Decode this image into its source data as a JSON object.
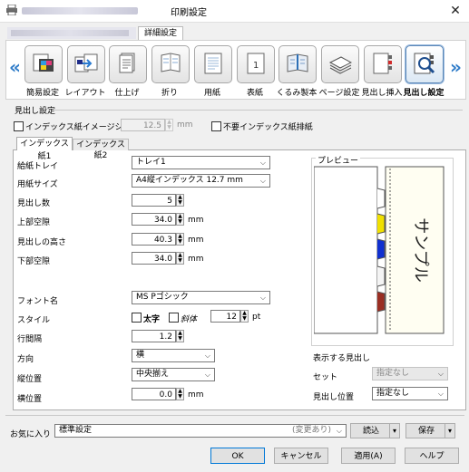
{
  "window": {
    "title": "印刷設定",
    "close_glyph": "✕"
  },
  "tabs": {
    "detail": "詳細設定"
  },
  "ribbon": {
    "items": [
      {
        "label": "簡易設定"
      },
      {
        "label": "レイアウト"
      },
      {
        "label": "仕上げ"
      },
      {
        "label": "折り"
      },
      {
        "label": "用紙"
      },
      {
        "label": "表紙"
      },
      {
        "label": "くるみ製本"
      },
      {
        "label": "ページ設定"
      },
      {
        "label": "見出し挿入"
      },
      {
        "label": "見出し設定"
      }
    ],
    "active_index": 9,
    "left_chevron": "«",
    "right_chevron": "»",
    "cover_icon_number": "1"
  },
  "section": {
    "title": "見出し設定",
    "shift_label": "インデックス紙イメージシフト",
    "shift_value": "12.5",
    "shift_unit": "mm",
    "discard_label": "不要インデックス紙排紙"
  },
  "subtabs": [
    "インデックス紙1",
    "インデックス紙2"
  ],
  "form": {
    "tray_label": "給紙トレイ",
    "tray_value": "トレイ1",
    "size_label": "用紙サイズ",
    "size_value": "A4縦インデックス 12.7 mm",
    "count_label": "見出し数",
    "count_value": "5",
    "top_label": "上部空隙",
    "top_value": "34.0",
    "height_label": "見出しの高さ",
    "height_value": "40.3",
    "bottom_label": "下部空隙",
    "bottom_value": "34.0",
    "unit": "mm",
    "font_label": "フォント名",
    "font_value": "MS Pゴシック",
    "style_label": "スタイル",
    "bold_label": "太字",
    "italic_label": "斜体",
    "size_pt_value": "12",
    "pt_unit": "pt",
    "spacing_label": "行間隔",
    "spacing_value": "1.2",
    "direction_label": "方向",
    "direction_value": "横",
    "vpos_label": "縦位置",
    "vpos_value": "中央揃え",
    "hpos_label": "横位置",
    "hpos_value": "0.0"
  },
  "preview": {
    "title": "プレビュー",
    "sample_text": "サンプル",
    "tab_colors": [
      "#ffffff",
      "#f0e000",
      "#1030d0",
      "#f4f4f4",
      "#9a2e22"
    ],
    "display_label": "表示する見出し",
    "set_label": "セット",
    "set_value": "指定なし",
    "pos_label": "見出し位置",
    "pos_value": "指定なし"
  },
  "favorites": {
    "label": "お気に入り",
    "value": "標準設定",
    "changed_note": "(変更あり)",
    "load_label": "読込",
    "save_label": "保存"
  },
  "footer": {
    "ok": "OK",
    "cancel": "キャンセル",
    "apply": "適用(A)",
    "help": "ヘルプ"
  },
  "colors": {
    "accent": "#2f7cc9",
    "active_border": "#5b87b8"
  }
}
